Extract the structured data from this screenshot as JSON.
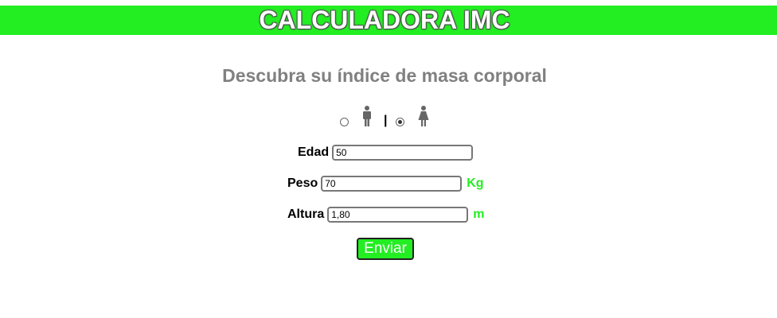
{
  "header": {
    "title": "CALCULADORA IMC"
  },
  "subtitle": "Descubra su índice de masa corporal",
  "gender": {
    "options": [
      {
        "icon": "male-icon",
        "selected": false
      },
      {
        "icon": "female-icon",
        "selected": true
      }
    ],
    "separator": "|"
  },
  "form": {
    "edad": {
      "label": "Edad",
      "value": "50"
    },
    "peso": {
      "label": "Peso",
      "value": "70",
      "unit": "Kg"
    },
    "altura": {
      "label": "Altura",
      "value": "1,80",
      "unit": "m"
    }
  },
  "submit": {
    "label": "Enviar"
  },
  "colors": {
    "accent": "#22ee22",
    "subtitle": "#808080",
    "icon": "#666666"
  }
}
